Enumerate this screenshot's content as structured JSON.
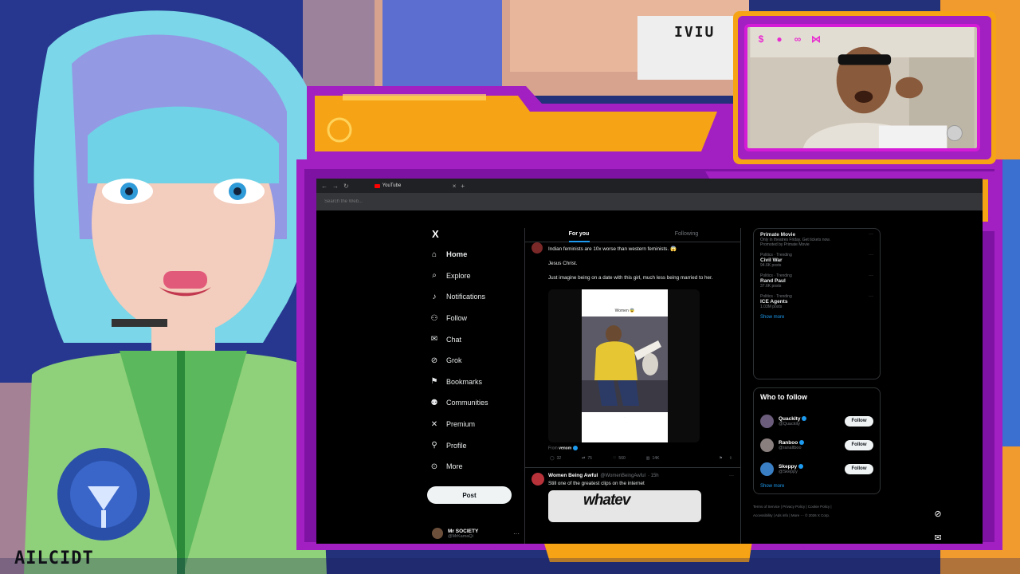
{
  "overlay": {
    "anime_label": "AILCIDT",
    "sign_text": "IVIU"
  },
  "browser": {
    "tab_title": "YouTube",
    "search_placeholder": "Search the Web..."
  },
  "x_nav": {
    "logo": "X",
    "items": [
      {
        "label": "Home",
        "icon": "home-icon"
      },
      {
        "label": "Explore",
        "icon": "search-icon"
      },
      {
        "label": "Notifications",
        "icon": "bell-icon"
      },
      {
        "label": "Follow",
        "icon": "add-person-icon"
      },
      {
        "label": "Chat",
        "icon": "mail-icon"
      },
      {
        "label": "Grok",
        "icon": "grok-icon"
      },
      {
        "label": "Bookmarks",
        "icon": "bookmark-icon"
      },
      {
        "label": "Communities",
        "icon": "people-icon"
      },
      {
        "label": "Premium",
        "icon": "x-icon"
      },
      {
        "label": "Profile",
        "icon": "person-icon"
      },
      {
        "label": "More",
        "icon": "more-circle-icon"
      }
    ],
    "post_label": "Post",
    "account_name": "Mr SOCIETY",
    "account_handle": "@MrKamaQi"
  },
  "feed": {
    "tab_for_you": "For you",
    "tab_following": "Following",
    "tweet1": {
      "line1": "Indian feminists are 10x worse than western feminists. 😱",
      "line2": "Jesus Christ.",
      "line3": "Just imagine being on a date with this girl, much less being married to her.",
      "media_title": "Women 😨",
      "from_label": "From",
      "from_name": "venom",
      "replies": "32",
      "reposts": "75",
      "likes": "560",
      "views": "14K"
    },
    "tweet2": {
      "author": "Women Being Awful",
      "handle": "@WomenBeingAwful",
      "time": "· 15h",
      "text": "Still one of the greatest clips on the internet",
      "media_text": "whatev"
    }
  },
  "trends": {
    "promo_title": "Primate Movie",
    "promo_sub": "Only in theatres Friday. Get tickets now.",
    "promo_tag": "Promoted by Primate Movie",
    "items": [
      {
        "category": "Politics · Trending",
        "title": "Civil War",
        "count": "94.6K posts"
      },
      {
        "category": "Politics · Trending",
        "title": "Rand Paul",
        "count": "37.6K posts"
      },
      {
        "category": "Politics · Trending",
        "title": "ICE Agents",
        "count": "1.03M posts"
      }
    ],
    "show_more": "Show more"
  },
  "who_to_follow": {
    "title": "Who to follow",
    "users": [
      {
        "name": "Quackity",
        "handle": "@Quackity",
        "color": "#6a5c7a"
      },
      {
        "name": "Ranboo",
        "handle": "@ranaltboo",
        "color": "#8a7f7f"
      },
      {
        "name": "Skeppy",
        "handle": "@Skeppy",
        "color": "#3a7fc4"
      }
    ],
    "follow_label": "Follow",
    "show_more": "Show more"
  },
  "footer": {
    "line1": "Terms of Service  |  Privacy Policy  |  Cookie Policy  |",
    "line2": "Accessibility  |  Ads info  |  More ···  © 2026 X Corp."
  },
  "colors": {
    "accent_purple": "#a21fc2",
    "accent_orange": "#f6a316",
    "x_blue": "#1d9bf0"
  }
}
